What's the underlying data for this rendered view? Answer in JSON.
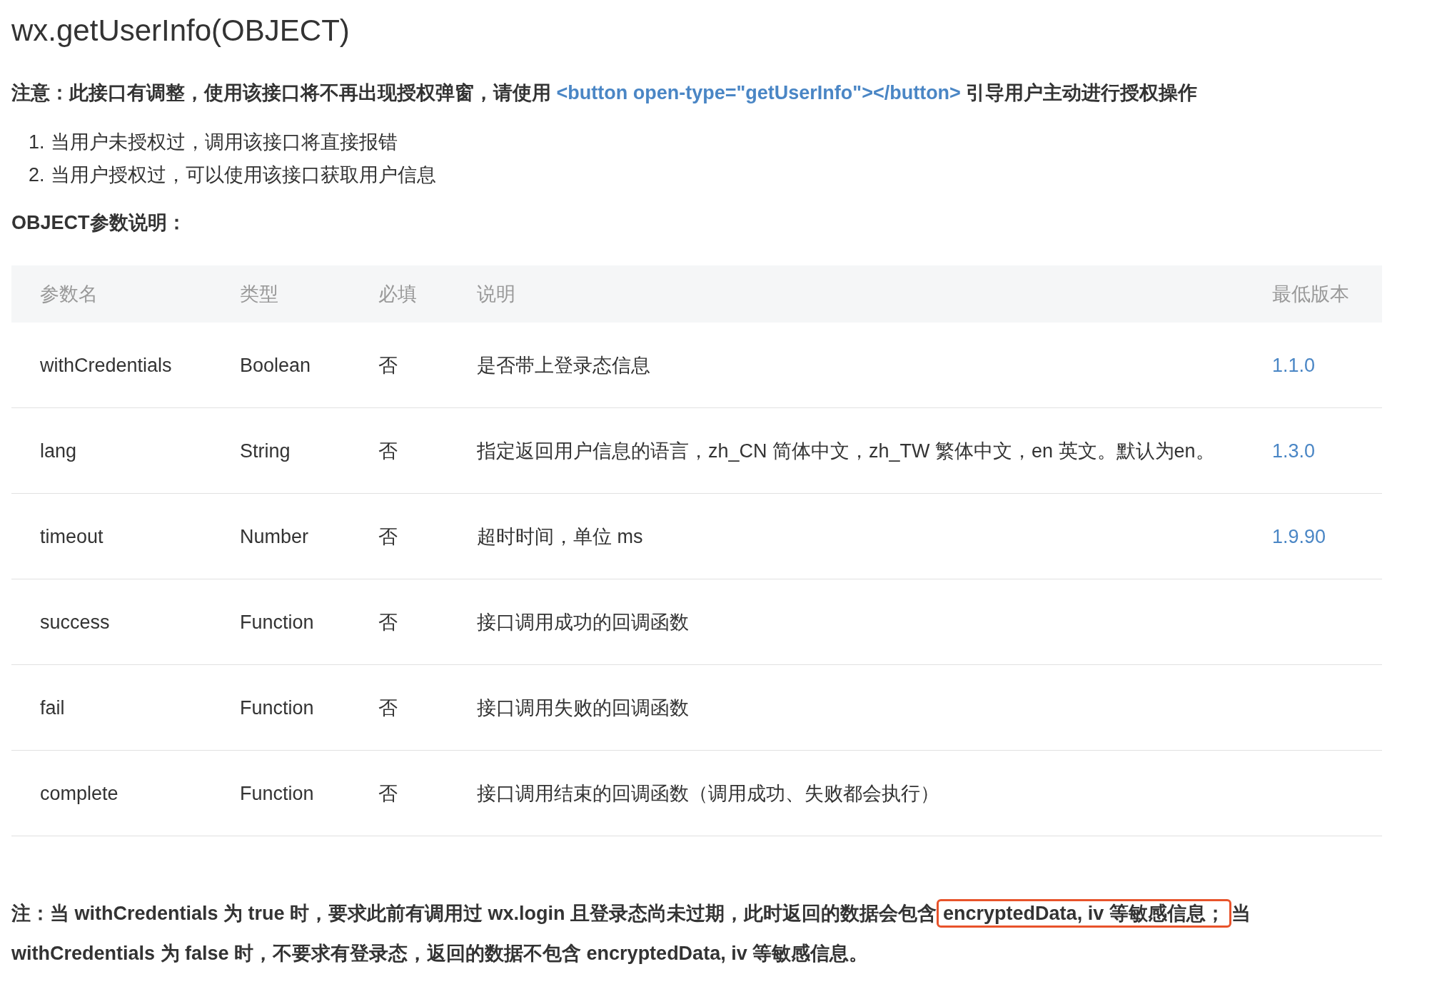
{
  "title": "wx.getUserInfo(OBJECT)",
  "notice": {
    "label": "注意：",
    "text_before": "此接口有调整，使用该接口将不再出现授权弹窗，请使用 ",
    "code": "<button open-type=\"getUserInfo\"></button>",
    "text_after": " 引导用户主动进行授权操作"
  },
  "list": [
    "当用户未授权过，调用该接口将直接报错",
    "当用户授权过，可以使用该接口获取用户信息"
  ],
  "list_markers": [
    "1.",
    "2."
  ],
  "section_heading": "OBJECT参数说明：",
  "table": {
    "columns": [
      "参数名",
      "类型",
      "必填",
      "说明",
      "最低版本"
    ],
    "rows": [
      {
        "cells": [
          "withCredentials",
          "Boolean",
          "否",
          "是否带上登录态信息",
          "1.1.0"
        ]
      },
      {
        "cells": [
          "lang",
          "String",
          "否",
          "指定返回用户信息的语言，zh_CN 简体中文，zh_TW 繁体中文，en 英文。默认为en。",
          "1.3.0"
        ]
      },
      {
        "cells": [
          "timeout",
          "Number",
          "否",
          "超时时间，单位 ms",
          "1.9.90"
        ]
      },
      {
        "cells": [
          "success",
          "Function",
          "否",
          "接口调用成功的回调函数",
          ""
        ]
      },
      {
        "cells": [
          "fail",
          "Function",
          "否",
          "接口调用失败的回调函数",
          ""
        ]
      },
      {
        "cells": [
          "complete",
          "Function",
          "否",
          "接口调用结束的回调函数（调用成功、失败都会执行）",
          ""
        ]
      }
    ]
  },
  "footnote": {
    "before": "注：当 withCredentials 为 true 时，要求此前有调用过 wx.login 且登录态尚未过期，此时返回的数据会包含",
    "highlighted": "encryptedData, iv 等敏感信息；",
    "after": "当",
    "second_line": "withCredentials 为 false 时，不要求有登录态，返回的数据不包含 encryptedData, iv 等敏感信息。"
  }
}
